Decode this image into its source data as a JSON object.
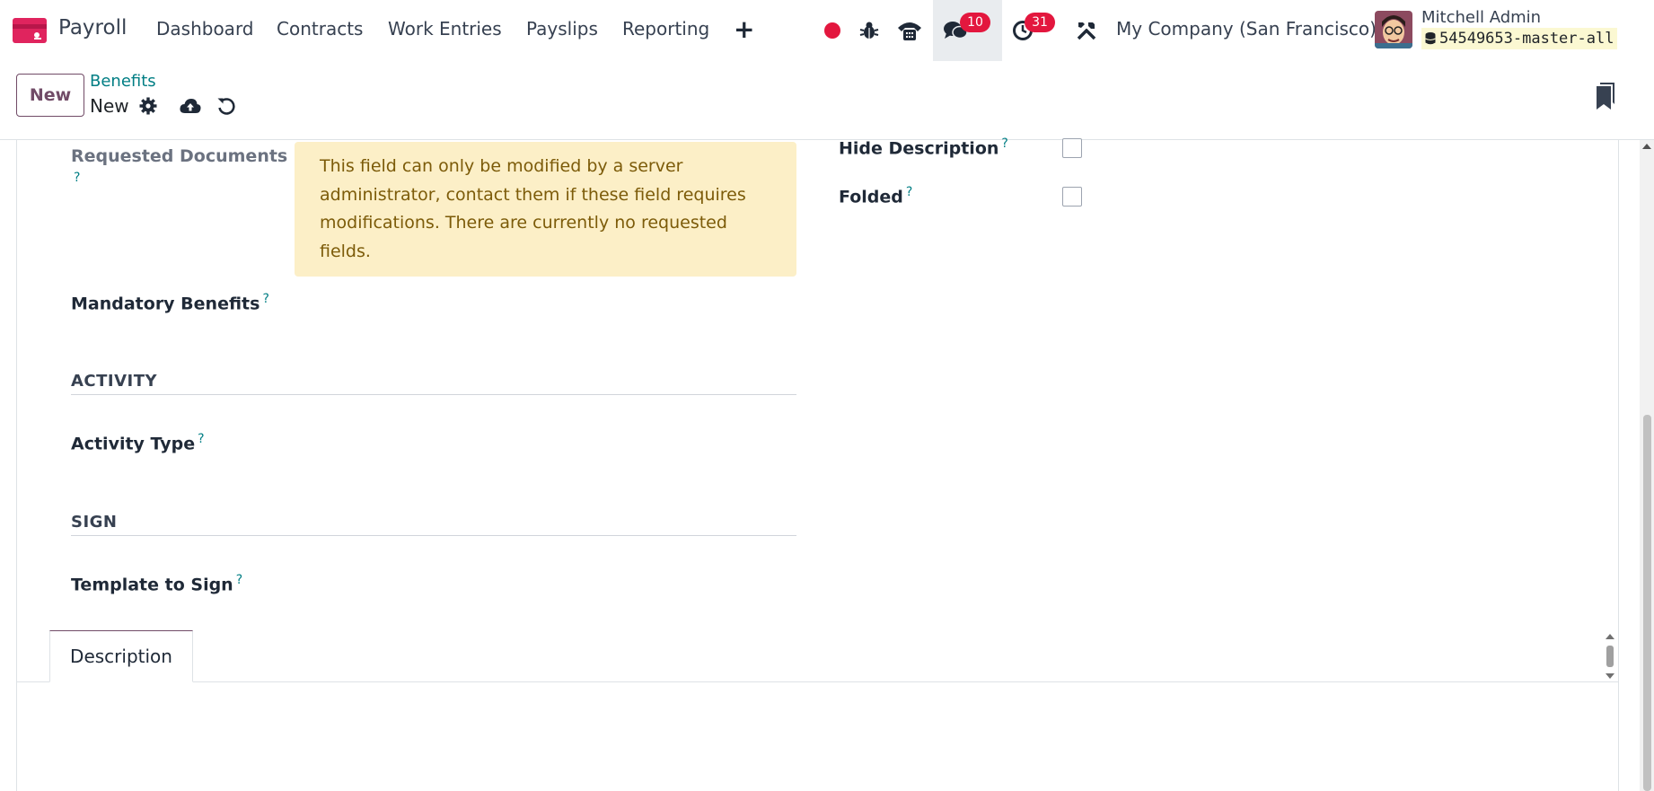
{
  "navbar": {
    "app_name": "Payroll",
    "menu": [
      "Dashboard",
      "Contracts",
      "Work Entries",
      "Payslips",
      "Reporting"
    ],
    "add_menu_icon": "plus-icon",
    "recording_icon": "record-dot-icon",
    "debug_icon": "bug-icon",
    "phone_icon": "phone-icon",
    "messages_icon": "chat-icon",
    "messages_count": "10",
    "activities_icon": "clock-icon",
    "activities_count": "31",
    "settings_icon": "tools-icon",
    "company": "My Company (San Francisco)",
    "user_name": "Mitchell Admin",
    "database": "54549653-master-all",
    "colors": {
      "brand": "#714b67",
      "link": "#017e84",
      "badge": "#e3173e",
      "record": "#e3173e"
    }
  },
  "control_panel": {
    "new_button": "New",
    "breadcrumb_parent": "Benefits",
    "breadcrumb_current": "New",
    "gear_icon": "gear-icon",
    "save_icon": "cloud-upload-icon",
    "discard_icon": "undo-icon",
    "bookmark_icon": "bookmark-icon"
  },
  "form": {
    "requested_documents_label": "Requested Documents",
    "help_mark": "?",
    "alert_text": "This field can only be modified by a server administrator, contact them if these field requires modifications. There are currently no requested fields.",
    "mandatory_benefits_label": "Mandatory Benefits",
    "activity_section": "ACTIVITY",
    "activity_type_label": "Activity Type",
    "sign_section": "SIGN",
    "template_to_sign_label": "Template to Sign",
    "hide_description_label": "Hide Description",
    "hide_description_checked": false,
    "folded_label": "Folded",
    "folded_checked": false
  },
  "tabs": [
    "Description"
  ]
}
